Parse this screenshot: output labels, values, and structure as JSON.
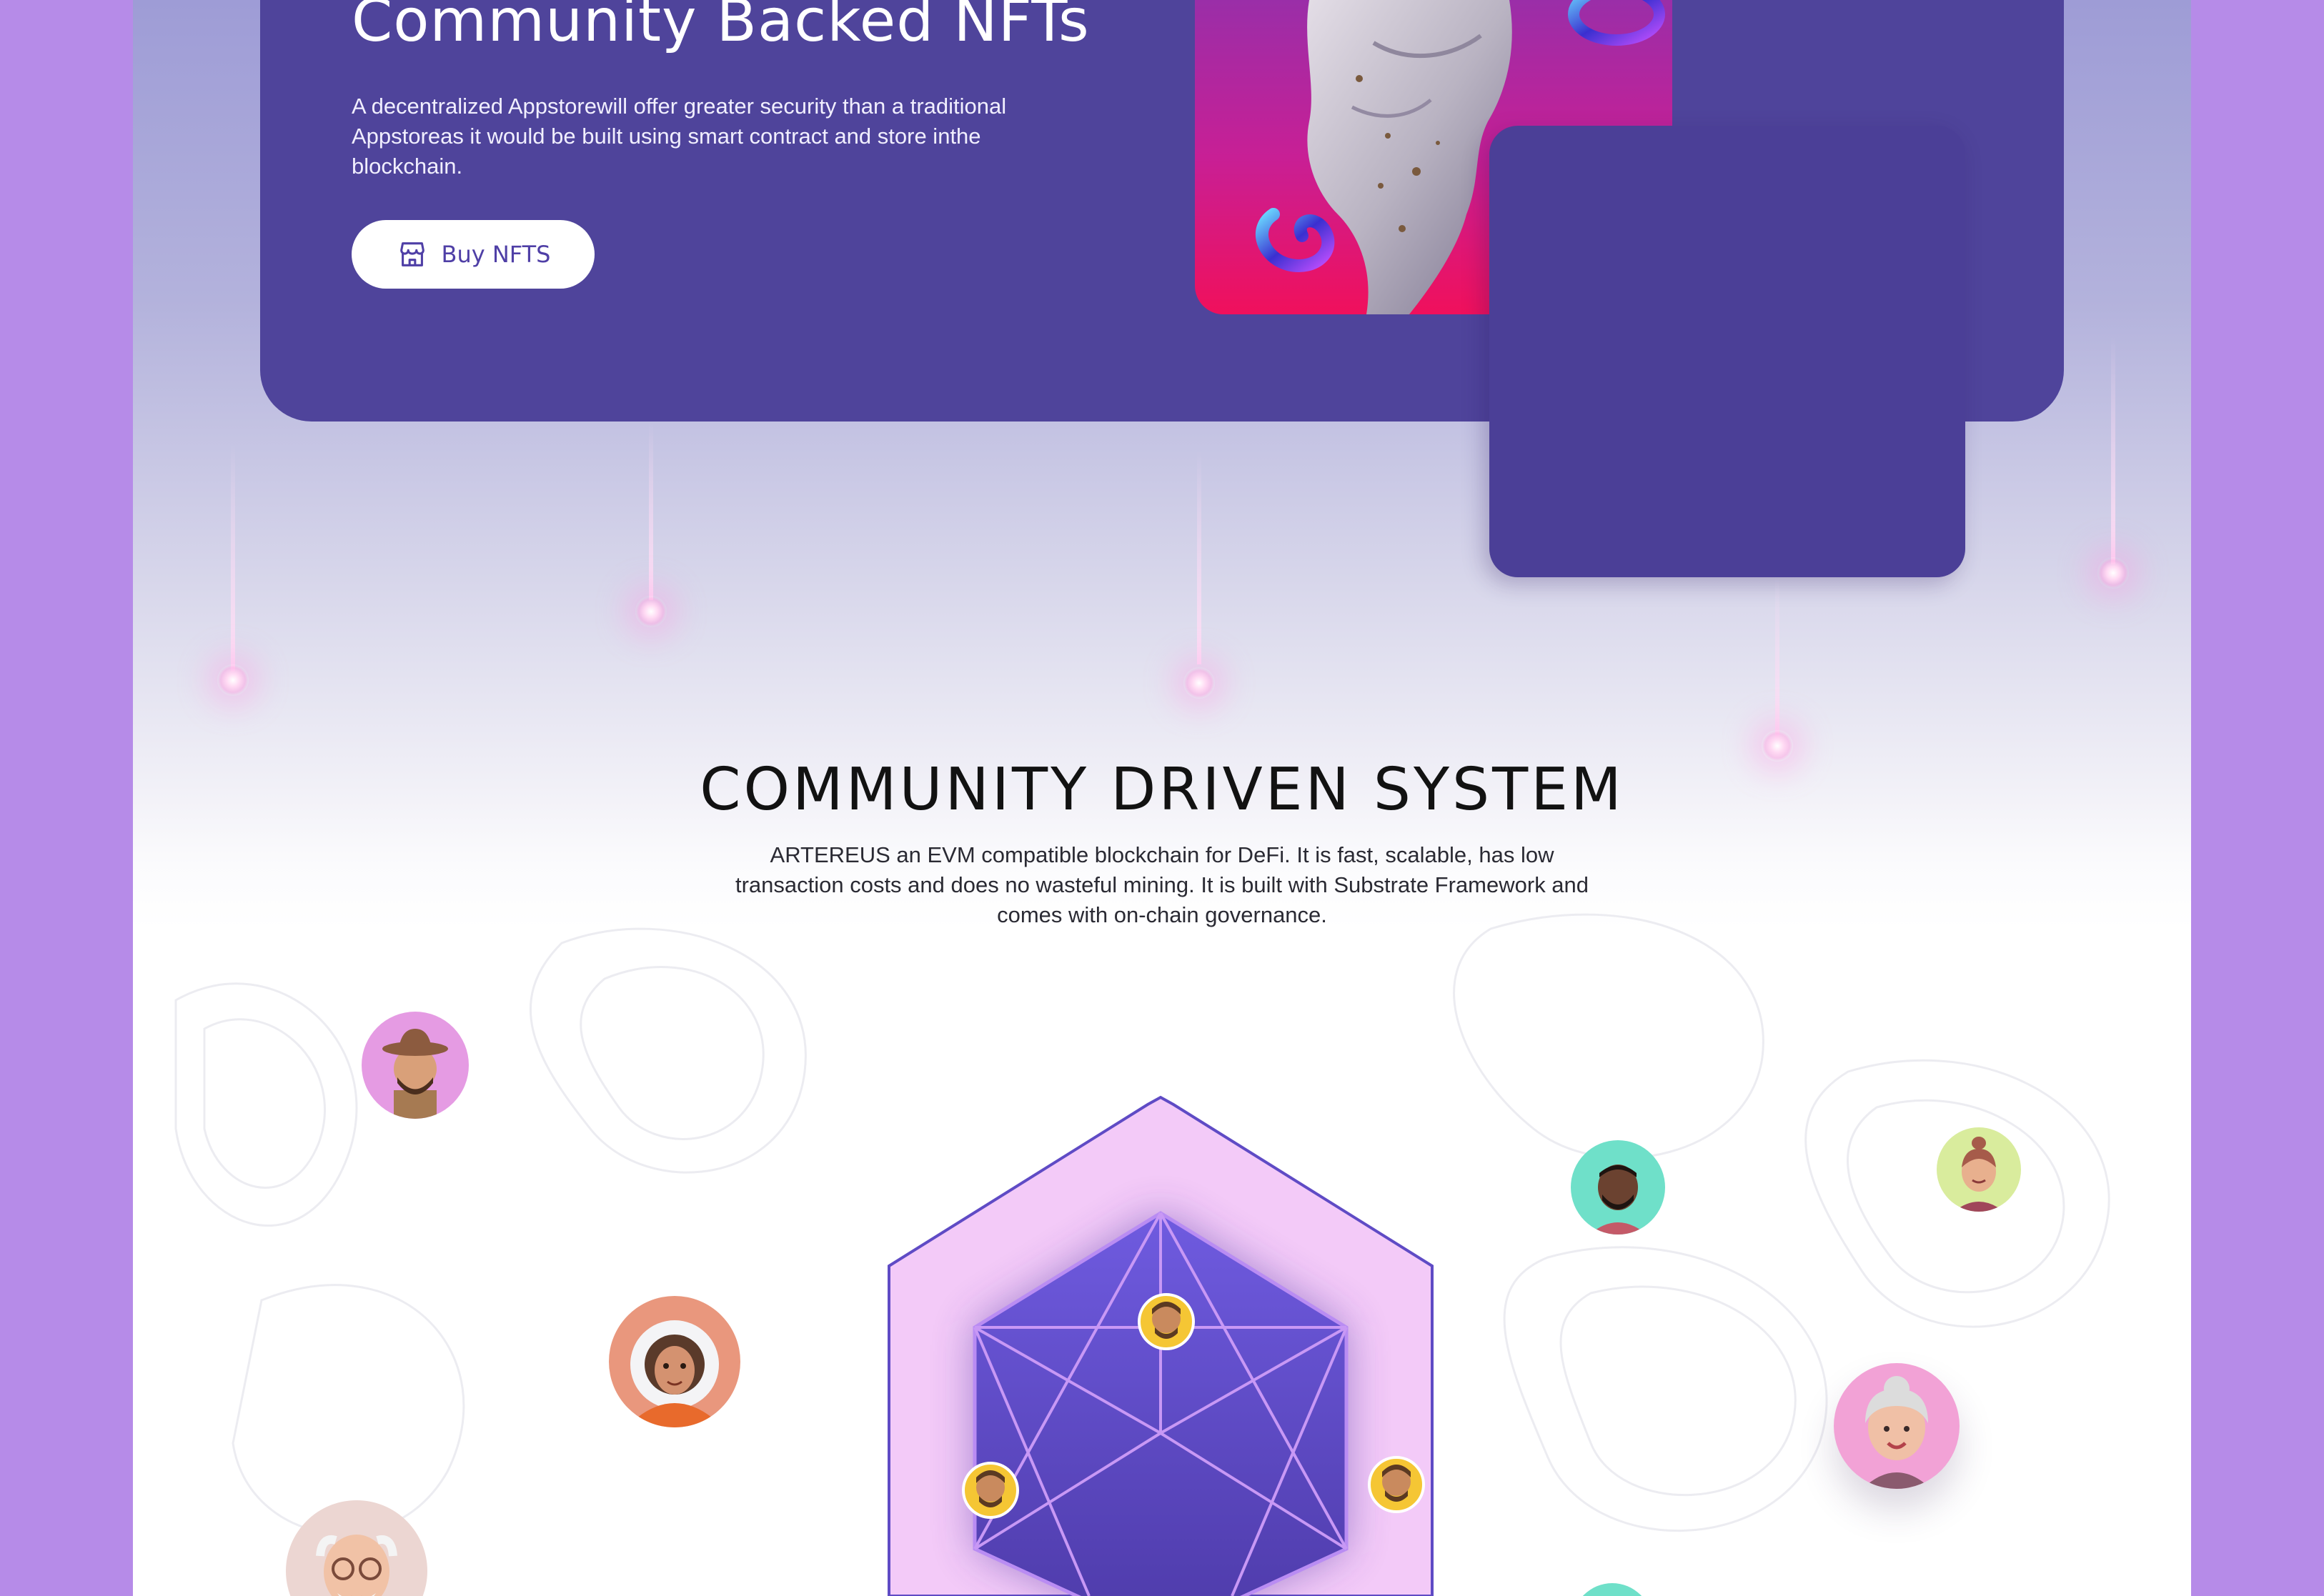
{
  "hero": {
    "title": "Community Backed NFTs",
    "description": "A decentralized Appstorewill offer greater security than a traditional Appstoreas it would be built using smart contract and store inthe blockchain.",
    "buy_button_label": "Buy NFTS",
    "buy_icon": "storefront-icon"
  },
  "section": {
    "title": "COMMUNITY DRIVEN SYSTEM",
    "description": "ARTEREUS an EVM compatible blockchain for DeFi. It is fast, scalable, has low transaction costs and does no wasteful mining. It is built with Substrate Framework and comes with on-chain governance."
  },
  "colors": {
    "page_background": "#b68be8",
    "hero_card": "#4f449b",
    "button_text": "#4f3fa6",
    "hexagon_outer": "#f3c8f7",
    "hexagon_inner": "#5a47c0"
  },
  "avatars": [
    {
      "name": "avatar-man-hat",
      "ring": "#e59be3"
    },
    {
      "name": "avatar-woman-astronaut",
      "ring": "#e9977d"
    },
    {
      "name": "avatar-elderly-man",
      "ring": "#ecd6d2"
    },
    {
      "name": "avatar-man-dark",
      "ring": "#6fe0c9"
    },
    {
      "name": "avatar-woman-ponytail",
      "ring": "#d9ec9d"
    },
    {
      "name": "avatar-elderly-woman",
      "ring": "#f2a2d6"
    }
  ]
}
